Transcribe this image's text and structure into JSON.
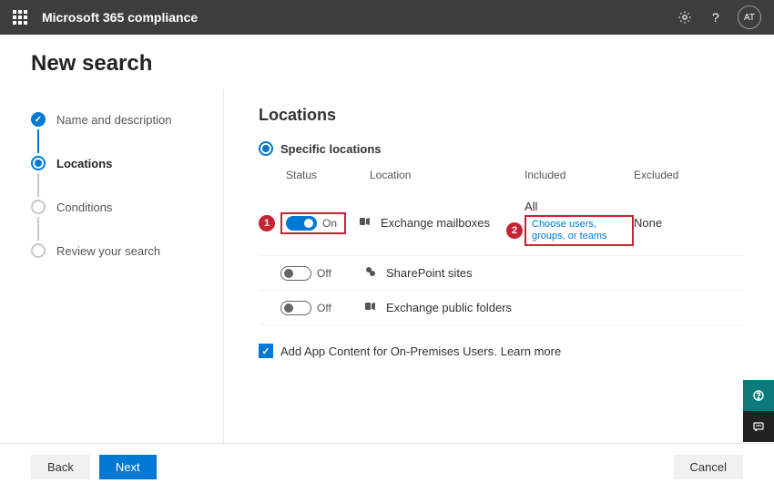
{
  "header": {
    "app_title": "Microsoft 365 compliance",
    "avatar_initials": "AT"
  },
  "page": {
    "title": "New search",
    "section_title": "Locations"
  },
  "stepper": {
    "items": [
      {
        "label": "Name and description"
      },
      {
        "label": "Locations"
      },
      {
        "label": "Conditions"
      },
      {
        "label": "Review your search"
      }
    ]
  },
  "radio": {
    "specific_label": "Specific locations"
  },
  "table": {
    "headers": {
      "status": "Status",
      "location": "Location",
      "included": "Included",
      "excluded": "Excluded"
    },
    "rows": [
      {
        "status": "On",
        "location": "Exchange mailboxes",
        "included": "All",
        "link": "Choose users, groups, or teams",
        "excluded": "None",
        "callout1": "1",
        "callout2": "2"
      },
      {
        "status": "Off",
        "location": "SharePoint sites"
      },
      {
        "status": "Off",
        "location": "Exchange public folders"
      }
    ]
  },
  "checkbox": {
    "label": "Add App Content for On-Premises Users.",
    "learn": "Learn more"
  },
  "footer": {
    "back": "Back",
    "next": "Next",
    "cancel": "Cancel"
  }
}
